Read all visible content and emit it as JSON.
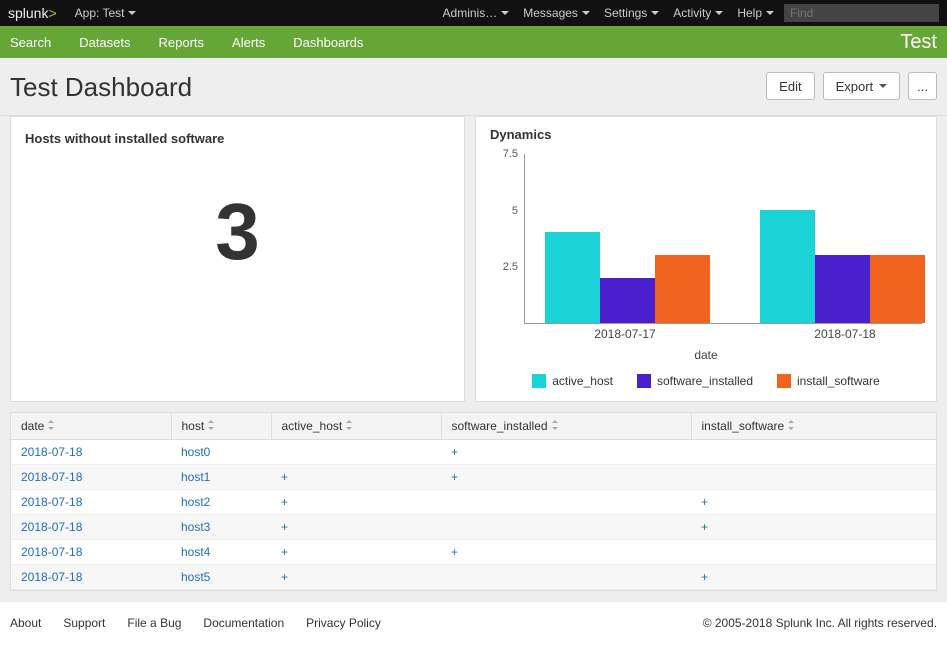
{
  "topbar": {
    "logo_text": "splunk",
    "logo_gt": ">",
    "app_label": "App: Test",
    "menu": [
      "Adminis…",
      "Messages",
      "Settings",
      "Activity",
      "Help"
    ],
    "find_placeholder": "Find"
  },
  "greenbar": {
    "nav": [
      "Search",
      "Datasets",
      "Reports",
      "Alerts",
      "Dashboards"
    ],
    "app_name": "Test"
  },
  "dash": {
    "title": "Test Dashboard",
    "edit_label": "Edit",
    "export_label": "Export",
    "more_label": "..."
  },
  "panel_single": {
    "title": "Hosts without installed software",
    "value": "3"
  },
  "panel_chart": {
    "title": "Dynamics"
  },
  "chart_data": {
    "type": "bar",
    "categories": [
      "2018-07-17",
      "2018-07-18"
    ],
    "series": [
      {
        "name": "active_host",
        "values": [
          4,
          5
        ],
        "color": "#1bd3d6"
      },
      {
        "name": "software_installed",
        "values": [
          2,
          3
        ],
        "color": "#4a1fce"
      },
      {
        "name": "install_software",
        "values": [
          3,
          3
        ],
        "color": "#f1641f"
      }
    ],
    "yticks": [
      2.5,
      5,
      7.5
    ],
    "ylim": [
      0,
      7.5
    ],
    "xlabel": "date"
  },
  "table": {
    "columns": [
      "date",
      "host",
      "active_host",
      "software_installed",
      "install_software"
    ],
    "rows": [
      {
        "date": "2018-07-18",
        "host": "host0",
        "active_host": "",
        "software_installed": "+",
        "install_software": ""
      },
      {
        "date": "2018-07-18",
        "host": "host1",
        "active_host": "+",
        "software_installed": "+",
        "install_software": ""
      },
      {
        "date": "2018-07-18",
        "host": "host2",
        "active_host": "+",
        "software_installed": "",
        "install_software": "+"
      },
      {
        "date": "2018-07-18",
        "host": "host3",
        "active_host": "+",
        "software_installed": "",
        "install_software": "+"
      },
      {
        "date": "2018-07-18",
        "host": "host4",
        "active_host": "+",
        "software_installed": "+",
        "install_software": ""
      },
      {
        "date": "2018-07-18",
        "host": "host5",
        "active_host": "+",
        "software_installed": "",
        "install_software": "+"
      }
    ]
  },
  "footer": {
    "links": [
      "About",
      "Support",
      "File a Bug",
      "Documentation",
      "Privacy Policy"
    ],
    "copyright": "© 2005-2018 Splunk Inc. All rights reserved."
  }
}
